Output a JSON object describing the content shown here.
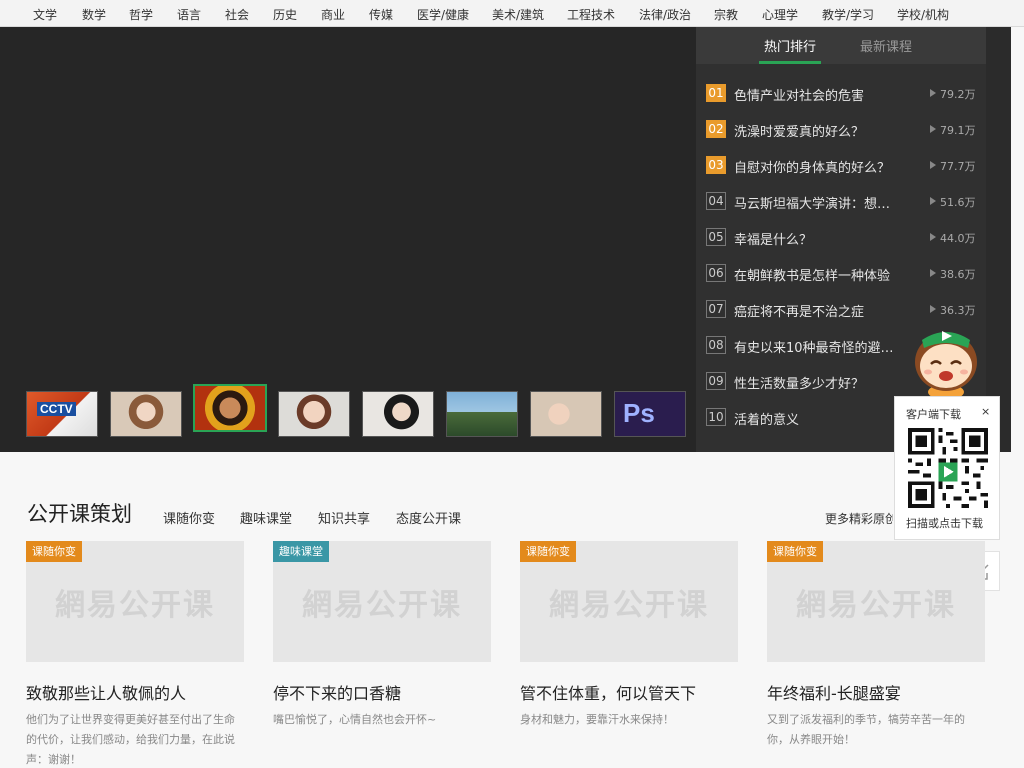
{
  "nav": {
    "items": [
      "文学",
      "数学",
      "哲学",
      "语言",
      "社会",
      "历史",
      "商业",
      "传媒",
      "医学/健康",
      "美术/建筑",
      "工程技术",
      "法律/政治",
      "宗教",
      "心理学",
      "教学/学习",
      "学校/机构"
    ]
  },
  "hero": {
    "thumbnails": [
      {
        "name": "cctv-thumbnail",
        "text": "CCTV"
      },
      {
        "name": "girl-thumbnail"
      },
      {
        "name": "singer-thumbnail",
        "active": true
      },
      {
        "name": "woman-smiling-thumbnail"
      },
      {
        "name": "dark-hair-girl-thumbnail"
      },
      {
        "name": "anime-thumbnail"
      },
      {
        "name": "couple-thumbnail"
      },
      {
        "name": "photoshop-thumbnail",
        "text": "Ps"
      }
    ]
  },
  "ranking": {
    "tab_hot": "热门排行",
    "tab_new": "最新课程",
    "items": [
      {
        "num": "01",
        "title": "色情产业对社会的危害",
        "count": "79.2万"
      },
      {
        "num": "02",
        "title": "洗澡时爱爱真的好么？",
        "count": "79.1万"
      },
      {
        "num": "03",
        "title": "自慰对你的身体真的好么？",
        "count": "77.7万"
      },
      {
        "num": "04",
        "title": "马云斯坦福大学演讲：想…",
        "count": "51.6万"
      },
      {
        "num": "05",
        "title": "幸福是什么？",
        "count": "44.0万"
      },
      {
        "num": "06",
        "title": "在朝鲜教书是怎样一种体验",
        "count": "38.6万"
      },
      {
        "num": "07",
        "title": "癌症将不再是不治之症",
        "count": "36.3万"
      },
      {
        "num": "08",
        "title": "有史以来10种最奇怪的避…",
        "count": ""
      },
      {
        "num": "09",
        "title": "性生活数量多少才好？",
        "count": ""
      },
      {
        "num": "10",
        "title": "活着的意义",
        "count": ""
      }
    ]
  },
  "client_popup": {
    "title": "客户端下载",
    "close": "×",
    "caption": "扫描或点击下载"
  },
  "section": {
    "title": "公开课策划",
    "tabs": [
      "课随你变",
      "趣味课堂",
      "知识共享",
      "态度公开课"
    ],
    "more": "更多精彩原创"
  },
  "cards": [
    {
      "badge": "课随你变",
      "badge_color": "#e38a1c",
      "logo": "網易公开课",
      "title": "致敬那些让人敬佩的人",
      "desc": "他们为了让世界变得更美好甚至付出了生命的代价，让我们感动，给我们力量，在此说声：谢谢！"
    },
    {
      "badge": "趣味课堂",
      "badge_color": "#3a97a6",
      "logo": "網易公开课",
      "title": "停不下来的口香糖",
      "desc": "嘴巴愉悦了，心情自然也会开怀~"
    },
    {
      "badge": "课随你变",
      "badge_color": "#e38a1c",
      "logo": "網易公开课",
      "title": "管不住体重，何以管天下",
      "desc": "身材和魅力，要靠汗水来保持！"
    },
    {
      "badge": "课随你变",
      "badge_color": "#e38a1c",
      "logo": "網易公开课",
      "title": "年终福利-长腿盛宴",
      "desc": "又到了派发福利的季节，犒劳辛苦一年的你，从养眼开始！"
    }
  ],
  "colors": {
    "accent_green": "#2aa455",
    "rank_highlight": "#e99b2c"
  }
}
